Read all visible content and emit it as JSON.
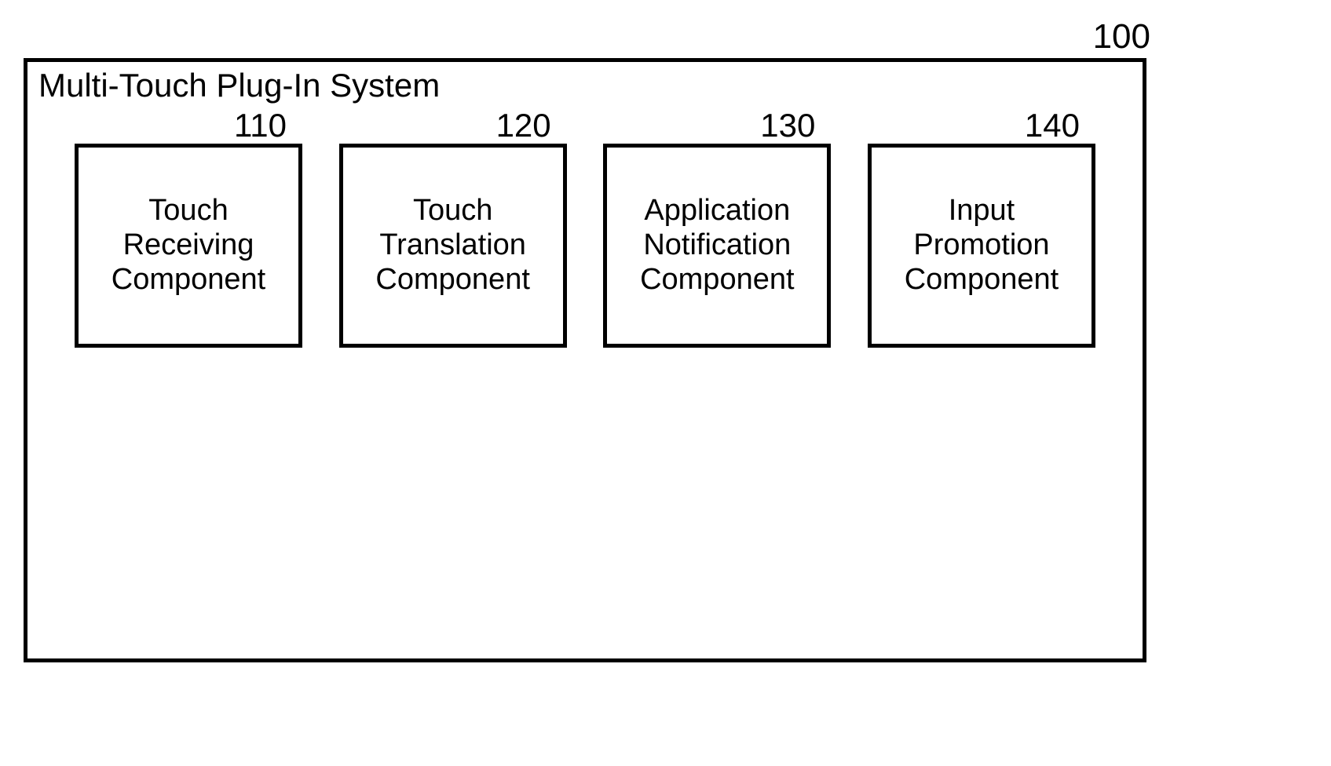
{
  "system": {
    "outer_ref": "100",
    "title": "Multi-Touch Plug-In System",
    "components": [
      {
        "ref": "110",
        "label": "Touch\nReceiving\nComponent"
      },
      {
        "ref": "120",
        "label": "Touch\nTranslation\nComponent"
      },
      {
        "ref": "130",
        "label": "Application\nNotification\nComponent"
      },
      {
        "ref": "140",
        "label": "Input\nPromotion\nComponent"
      }
    ]
  }
}
